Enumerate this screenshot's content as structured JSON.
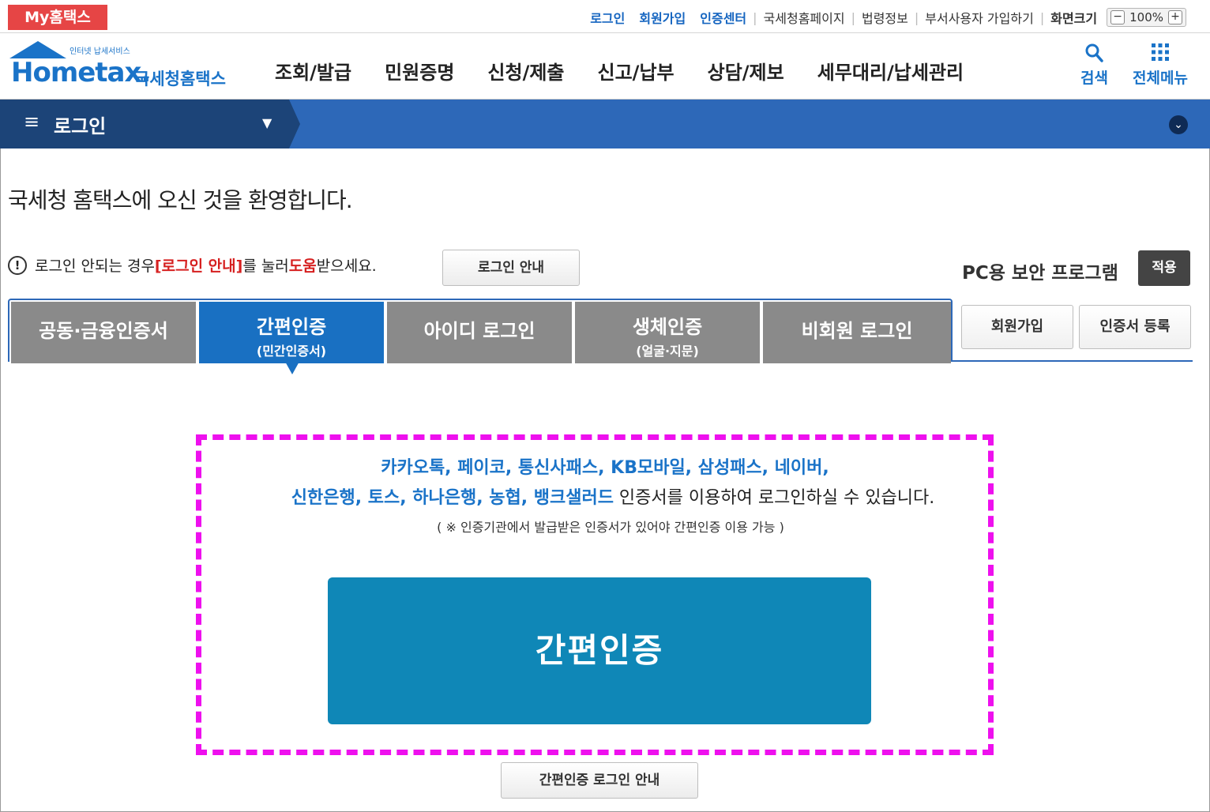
{
  "utility": {
    "my_hometax": "My홈택스",
    "login": "로그인",
    "signup": "회원가입",
    "cert_center": "인증센터",
    "nts_home": "국세청홈페이지",
    "law_info": "법령정보",
    "dept_user": "부서사용자 가입하기",
    "screen_size": "화면크기",
    "zoom_minus": "−",
    "zoom_value": "100%",
    "zoom_plus": "+"
  },
  "header": {
    "logo_sub": "인터넷 납세서비스",
    "logo_main": "Hometax.",
    "logo_kr": "국세청홈택스",
    "gnb": [
      "조회/발급",
      "민원증명",
      "신청/제출",
      "신고/납부",
      "상담/제보",
      "세무대리/납세관리"
    ],
    "search": "검색",
    "all_menu": "전체메뉴"
  },
  "navbar": {
    "title": "로그인"
  },
  "welcome": "국세청 홈택스에 오신 것을 환영합니다.",
  "notice": {
    "text1": "로그인 안되는 경우 ",
    "bracket": "[로그인 안내]",
    "text2": "를 눌러 ",
    "help": "도움",
    "text3": "받으세요.",
    "guide_button": "로그인 안내"
  },
  "pc_security": {
    "label": "PC용 보안 프로그램",
    "apply": "적용"
  },
  "tabs": [
    {
      "label": "공동·금융인증서",
      "sub": ""
    },
    {
      "label": "간편인증",
      "sub": "(민간인증서)"
    },
    {
      "label": "아이디 로그인",
      "sub": ""
    },
    {
      "label": "생체인증",
      "sub": "(얼굴·지문)"
    },
    {
      "label": "비회원 로그인",
      "sub": ""
    }
  ],
  "side_buttons": {
    "signup": "회원가입",
    "cert_register": "인증서 등록"
  },
  "simple_auth": {
    "providers_line1": "카카오톡, 페이코, 통신사패스, KB모바일, 삼성패스, 네이버,",
    "providers_line2": "신한은행, 토스, 하나은행, 농협, 뱅크샐러드",
    "line2_suffix": " 인증서를 이용하여 로그인하실 수 있습니다.",
    "note": "( ※ 인증기관에서 발급받은 인증서가 있어야 간편인증 이용 가능 )",
    "button": "간편인증",
    "guide_button": "간편인증 로그인 안내"
  },
  "colors": {
    "brand_blue": "#1a73c8",
    "nav_dark": "#1c4478",
    "nav_blue": "#2d68b8",
    "active_tab": "#1970c2",
    "inactive_tab": "#8a8a8a",
    "auth_button": "#0f87b7",
    "highlight_dash": "#ee10ee",
    "alert_red": "#d62020"
  }
}
